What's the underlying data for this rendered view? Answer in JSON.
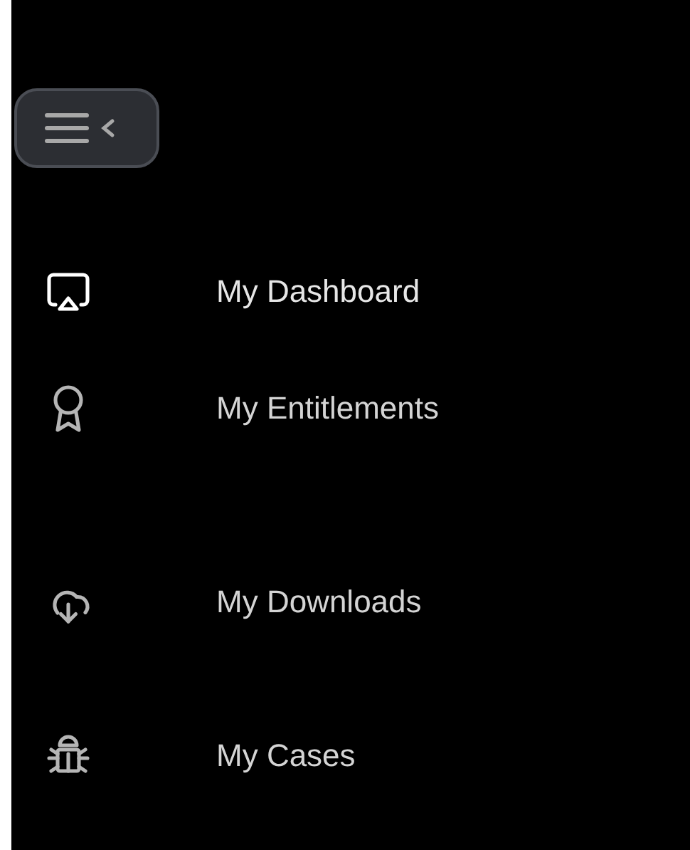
{
  "sidebar": {
    "toggle": {
      "expanded": true
    },
    "items": [
      {
        "label": "My Dashboard",
        "kind": "dashboard",
        "selected": true
      },
      {
        "label": "My Entitlements",
        "kind": "entitlements",
        "selected": false
      },
      {
        "label": "My Downloads",
        "kind": "downloads",
        "selected": false
      },
      {
        "label": "My Cases",
        "kind": "cases",
        "selected": false
      }
    ]
  }
}
